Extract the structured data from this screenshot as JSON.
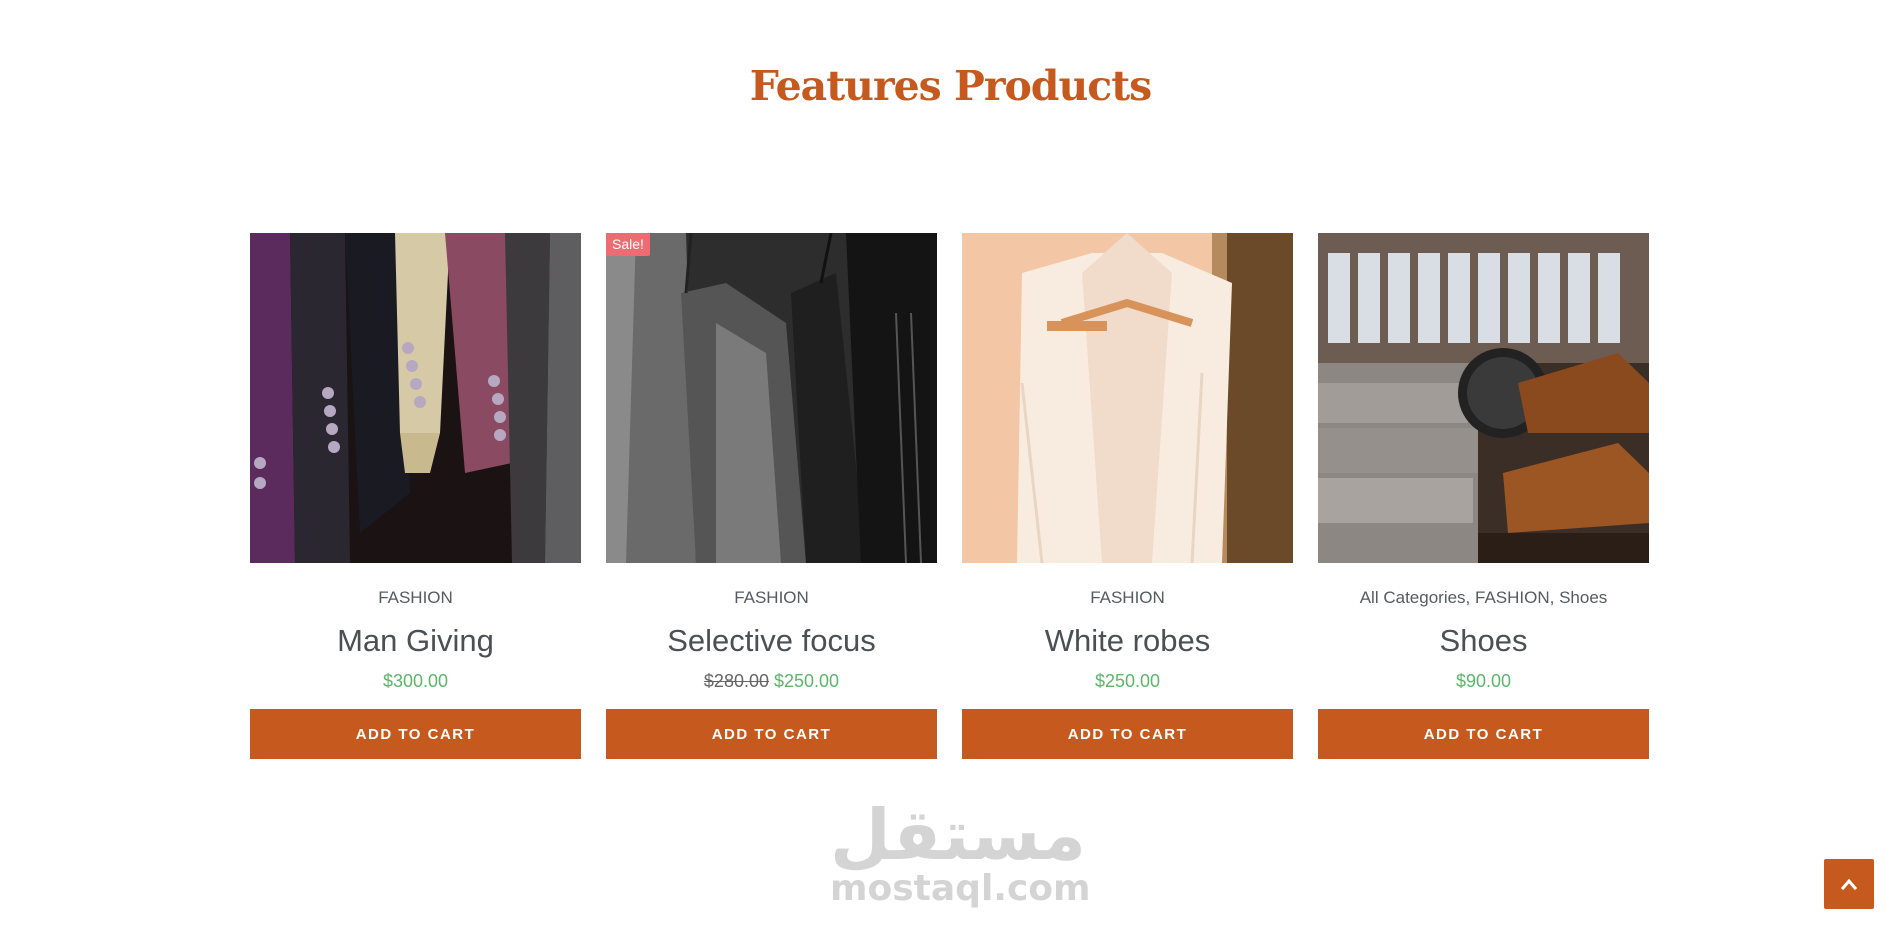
{
  "section": {
    "title": "Features Products"
  },
  "products": [
    {
      "categories": [
        "FASHION"
      ],
      "name": "Man Giving",
      "price": "$300.00",
      "button_label": "ADD TO CART"
    },
    {
      "badge": "Sale!",
      "categories": [
        "FASHION"
      ],
      "name": "Selective focus",
      "old_price": "$280.00",
      "price": "$250.00",
      "button_label": "ADD TO CART"
    },
    {
      "categories": [
        "FASHION"
      ],
      "name": "White robes",
      "price": "$250.00",
      "button_label": "ADD TO CART"
    },
    {
      "categories": [
        "All Categories",
        "FASHION",
        "Shoes"
      ],
      "categories_text": "All Categories, FASHION, Shoes",
      "name": "Shoes",
      "price": "$90.00",
      "button_label": "ADD TO CART"
    }
  ],
  "watermark": {
    "arabic": "مستقل",
    "latin": "mostaql.com"
  },
  "back_to_top": {
    "icon": "chevron-up-icon"
  },
  "colors": {
    "accent": "#c65a1e",
    "price": "#5bb66a",
    "sale_badge": "#ef6b72",
    "text": "#4a5054"
  }
}
